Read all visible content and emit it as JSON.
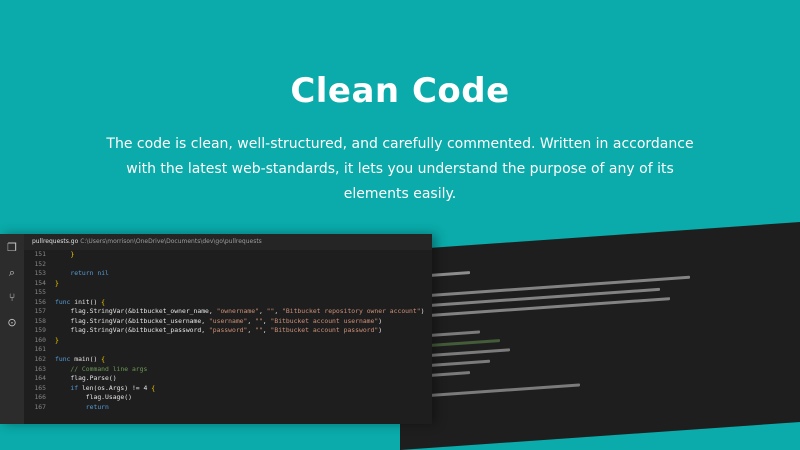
{
  "hero": {
    "title": "Clean Code",
    "description": "The code is clean, well-structured, and carefully commented. Written in accordance with the latest web-standards, it lets you understand the purpose of any of its elements easily."
  },
  "editor": {
    "file_name": "pullrequests.go",
    "file_path": "C:\\Users\\morrison\\OneDrive\\Documents\\dev\\go\\pullrequests",
    "activity_icons": [
      "files-icon",
      "search-icon",
      "git-icon",
      "debug-icon"
    ],
    "lines": [
      {
        "n": "151",
        "t": "    }"
      },
      {
        "n": "152",
        "t": ""
      },
      {
        "n": "153",
        "t": "    return nil"
      },
      {
        "n": "154",
        "t": "}"
      },
      {
        "n": "155",
        "t": ""
      },
      {
        "n": "156",
        "t": "func init() {"
      },
      {
        "n": "157",
        "t": "    flag.StringVar(&bitbucket_owner_name, \"ownername\", \"\", \"Bitbucket repository owner account\")"
      },
      {
        "n": "158",
        "t": "    flag.StringVar(&bitbucket_username, \"username\", \"\", \"Bitbucket account username\")"
      },
      {
        "n": "159",
        "t": "    flag.StringVar(&bitbucket_password, \"password\", \"\", \"Bitbucket account password\")"
      },
      {
        "n": "160",
        "t": "}"
      },
      {
        "n": "161",
        "t": ""
      },
      {
        "n": "162",
        "t": "func main() {"
      },
      {
        "n": "163",
        "t": "    // Command line args"
      },
      {
        "n": "164",
        "t": "    flag.Parse()"
      },
      {
        "n": "165",
        "t": "    if len(os.Args) != 4 {"
      },
      {
        "n": "166",
        "t": "        flag.Usage()"
      },
      {
        "n": "167",
        "t": "        return"
      }
    ]
  },
  "colors": {
    "background": "#0aabaa",
    "editor_bg": "#1e1e1e",
    "keyword": "#569cd6",
    "string": "#ce9178",
    "comment": "#6a9955"
  }
}
